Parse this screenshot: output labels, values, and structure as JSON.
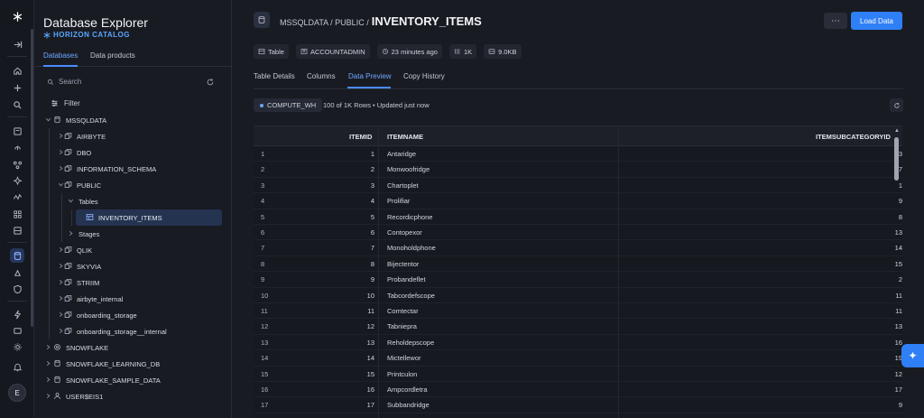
{
  "sidebar": {
    "title": "Database Explorer",
    "subtitle": "HORIZON CATALOG",
    "tabs": [
      "Databases",
      "Data products"
    ],
    "search_placeholder": "Search",
    "filter_label": "Filter",
    "tree": [
      {
        "label": "MSSQLDATA",
        "level": 0,
        "expanded": true,
        "icon": "database-icon"
      },
      {
        "label": "AIRBYTE",
        "level": 1,
        "expanded": false,
        "icon": "schema-icon"
      },
      {
        "label": "DBO",
        "level": 1,
        "expanded": false,
        "icon": "schema-icon"
      },
      {
        "label": "INFORMATION_SCHEMA",
        "level": 1,
        "expanded": false,
        "icon": "schema-icon"
      },
      {
        "label": "PUBLIC",
        "level": 1,
        "expanded": true,
        "icon": "schema-icon"
      },
      {
        "label": "Tables",
        "level": 2,
        "expanded": true,
        "icon": ""
      },
      {
        "label": "INVENTORY_ITEMS",
        "level": 3,
        "selected": true,
        "icon": "table-icon"
      },
      {
        "label": "Stages",
        "level": 2,
        "expanded": false,
        "icon": ""
      },
      {
        "label": "QLIK",
        "level": 1,
        "expanded": false,
        "icon": "schema-icon"
      },
      {
        "label": "SKYVIA",
        "level": 1,
        "expanded": false,
        "icon": "schema-icon"
      },
      {
        "label": "STRIIM",
        "level": 1,
        "expanded": false,
        "icon": "schema-icon"
      },
      {
        "label": "airbyte_internal",
        "level": 1,
        "expanded": false,
        "icon": "schema-icon"
      },
      {
        "label": "onboarding_storage",
        "level": 1,
        "expanded": false,
        "icon": "schema-icon"
      },
      {
        "label": "onboarding_storage__internal",
        "level": 1,
        "expanded": false,
        "icon": "schema-icon"
      },
      {
        "label": "SNOWFLAKE",
        "level": 0,
        "expanded": false,
        "icon": "snowflake-db-icon"
      },
      {
        "label": "SNOWFLAKE_LEARNING_DB",
        "level": 0,
        "expanded": false,
        "icon": "database-icon"
      },
      {
        "label": "SNOWFLAKE_SAMPLE_DATA",
        "level": 0,
        "expanded": false,
        "icon": "database-icon"
      },
      {
        "label": "USER$EIS1",
        "level": 0,
        "expanded": false,
        "icon": "user-icon"
      }
    ]
  },
  "rail": {
    "avatar_letter": "E"
  },
  "header": {
    "breadcrumb_prefix": "MSSQLDATA / PUBLIC /",
    "current": "INVENTORY_ITEMS",
    "more_label": "⋯",
    "load_data_label": "Load Data"
  },
  "meta": {
    "type": "Table",
    "owner": "ACCOUNTADMIN",
    "updated": "23 minutes ago",
    "rows": "1K",
    "size": "9.0KB"
  },
  "tabs": [
    "Table Details",
    "Columns",
    "Data Preview",
    "Copy History"
  ],
  "active_tab": "Data Preview",
  "preview": {
    "warehouse": "COMPUTE_WH",
    "rows_info": "100 of 1K Rows • Updated just now",
    "columns": [
      "ITEMID",
      "ITEMNAME",
      "ITEMSUBCATEGORYID"
    ],
    "rows": [
      [
        "1",
        "1",
        "Antaridge",
        "3"
      ],
      [
        "2",
        "2",
        "Monwoofridge",
        "7"
      ],
      [
        "3",
        "3",
        "Chartoplet",
        "1"
      ],
      [
        "4",
        "4",
        "Prolifiar",
        "9"
      ],
      [
        "5",
        "5",
        "Recordicphone",
        "8"
      ],
      [
        "6",
        "6",
        "Contopexor",
        "13"
      ],
      [
        "7",
        "7",
        "Monoholdphone",
        "14"
      ],
      [
        "8",
        "8",
        "Bijectentor",
        "15"
      ],
      [
        "9",
        "9",
        "Probandeflet",
        "2"
      ],
      [
        "10",
        "10",
        "Tabcordefscope",
        "11"
      ],
      [
        "11",
        "11",
        "Comtectar",
        "11"
      ],
      [
        "12",
        "12",
        "Tabniepra",
        "13"
      ],
      [
        "13",
        "13",
        "Reholdepscope",
        "16"
      ],
      [
        "14",
        "14",
        "Mictellewor",
        "19"
      ],
      [
        "15",
        "15",
        "Printculon",
        "12"
      ],
      [
        "16",
        "16",
        "Ampcordletra",
        "17"
      ],
      [
        "17",
        "17",
        "Subbandridge",
        "9"
      ]
    ]
  },
  "colors": {
    "accent": "#2f7ff7",
    "link": "#6ea8ff",
    "background": "#191b23"
  }
}
